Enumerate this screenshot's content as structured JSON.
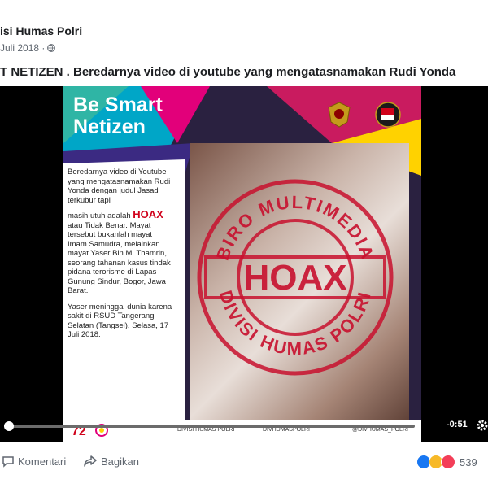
{
  "post": {
    "author": "isi Humas Polri",
    "date": "Juli 2018 ·",
    "text": "T NETIZEN . Beredarnya video di youtube yang mengatasnamakan Rudi Yonda"
  },
  "poster": {
    "title_line1": "Be Smart",
    "title_line2": "Netizen",
    "body_part1": "Beredarnya video di Youtube yang mengatasnamakan Rudi Yonda dengan judul Jasad terkubur tapi",
    "body_part2": "masih utuh adalah",
    "body_hoax": "HOAX",
    "body_part3": "atau Tidak Benar. Mayat tersebut bukanlah mayat Imam Samudra, melainkan mayat Yaser Bin M. Thamrin, seorang tahanan kasus tindak pidana terorisme di Lapas Gunung Sindur, Bogor, Jawa Barat.",
    "body_part4": "Yaser meninggal dunia karena sakit di RSUD Tangerang Selatan (Tangsel), Selasa, 17 Juli 2018.",
    "stamp_top": "BIRO MULTIMEDIA",
    "stamp_center": "HOAX",
    "stamp_bottom": "DIVISI HUMAS POLRI",
    "footer_1": "DIVISI HUMAS POLRI",
    "footer_2": "DIVHUMASPOLRI",
    "footer_3": "@DIVHUMAS_POLRI"
  },
  "video": {
    "time_remaining": "-0:51",
    "progress": 0.0
  },
  "actions": {
    "comment_label": "Komentari",
    "share_label": "Bagikan",
    "reaction_count": "539"
  },
  "colors": {
    "accent_red": "#d0021b",
    "facebook_blue": "#1877f2"
  }
}
